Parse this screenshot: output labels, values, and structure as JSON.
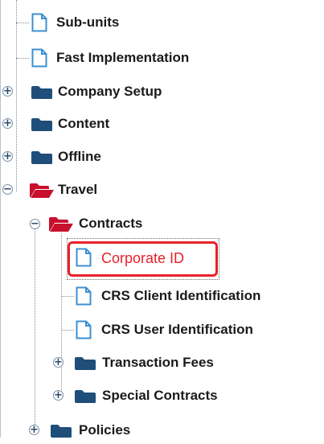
{
  "tree": {
    "items": [
      {
        "label": "Sub-units",
        "icon": "document-icon",
        "expander": ""
      },
      {
        "label": "Fast Implementation",
        "icon": "document-icon",
        "expander": ""
      },
      {
        "label": "Company Setup",
        "icon": "folder-closed-icon",
        "expander": "plus"
      },
      {
        "label": "Content",
        "icon": "folder-closed-icon",
        "expander": "plus"
      },
      {
        "label": "Offline",
        "icon": "folder-closed-icon",
        "expander": "plus"
      },
      {
        "label": "Travel",
        "icon": "folder-open-icon",
        "expander": "minus"
      },
      {
        "label": "Contracts",
        "icon": "folder-open-icon",
        "expander": "minus"
      },
      {
        "label": "Corporate ID",
        "icon": "document-icon",
        "expander": "",
        "selected": true
      },
      {
        "label": "CRS Client Identification",
        "icon": "document-icon",
        "expander": ""
      },
      {
        "label": "CRS User Identification",
        "icon": "document-icon",
        "expander": ""
      },
      {
        "label": "Transaction Fees",
        "icon": "folder-closed-icon",
        "expander": "plus"
      },
      {
        "label": "Special Contracts",
        "icon": "folder-closed-icon",
        "expander": "plus"
      },
      {
        "label": "Policies",
        "icon": "folder-closed-icon",
        "expander": "plus"
      }
    ]
  },
  "colors": {
    "folder": "#1f4e7a",
    "folder_open": "#c8102e",
    "document_outline": "#3d8fd1",
    "selection": "#e8202a"
  },
  "glyphs": {
    "plus": "+",
    "minus": "−"
  }
}
